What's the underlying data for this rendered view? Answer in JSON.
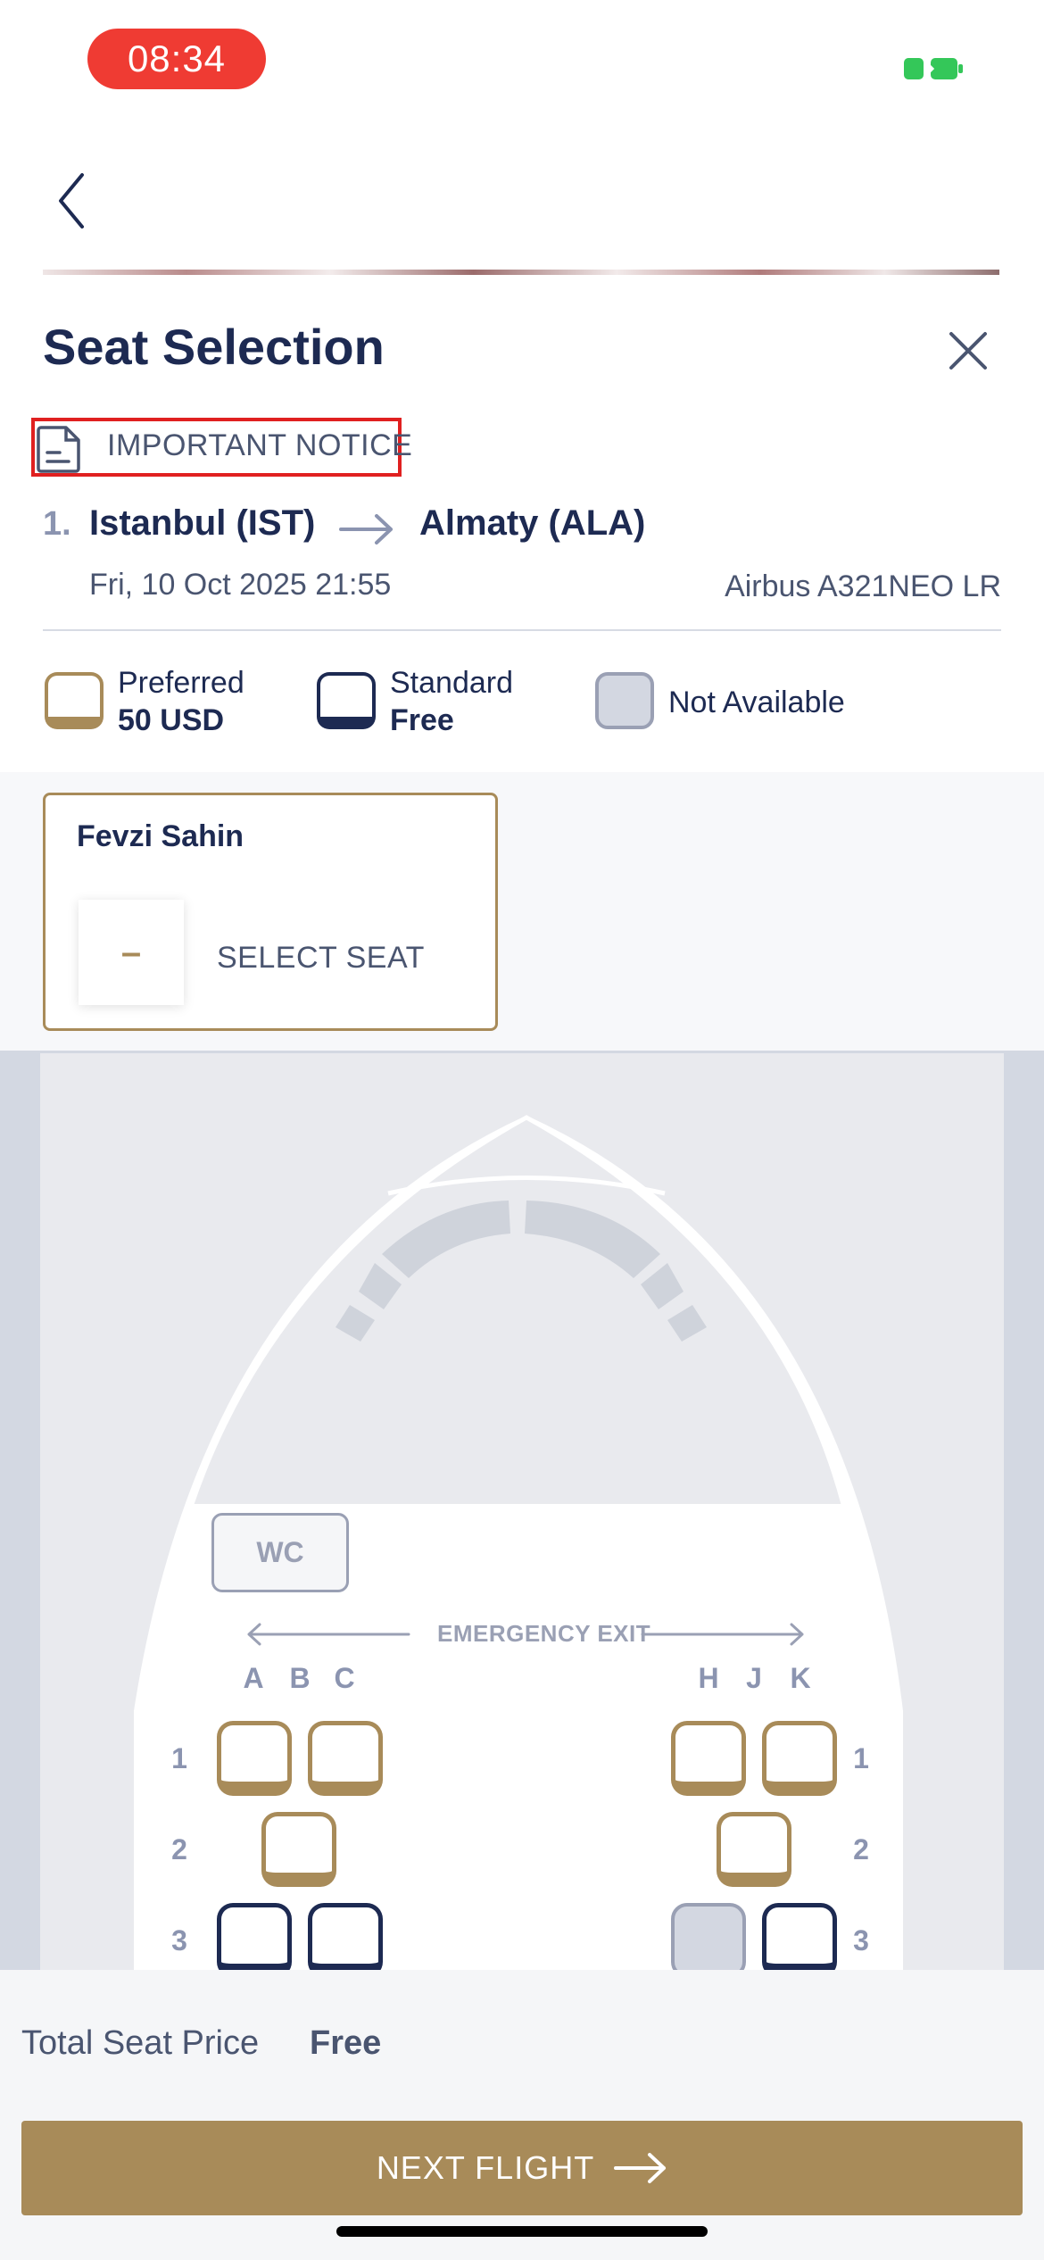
{
  "status_bar": {
    "time": "08:34"
  },
  "header": {
    "title": "Seat Selection",
    "notice": "IMPORTANT NOTICE"
  },
  "segment": {
    "number": "1.",
    "from": "Istanbul (IST)",
    "to": "Almaty (ALA)",
    "datetime": "Fri, 10 Oct 2025 21:55",
    "aircraft": "Airbus A321NEO LR"
  },
  "legend": {
    "preferred_label": "Preferred",
    "preferred_price": "50 USD",
    "standard_label": "Standard",
    "standard_price": "Free",
    "na_label": "Not Available"
  },
  "passenger": {
    "name": "Fevzi Sahin",
    "seat": "–",
    "action": "SELECT SEAT"
  },
  "seat_map": {
    "wc_label": "WC",
    "exit_label": "EMERGENCY EXIT",
    "left_columns": [
      "A",
      "B",
      "C"
    ],
    "right_columns": [
      "H",
      "J",
      "K"
    ],
    "rows": [
      {
        "label": "1",
        "seats": [
          {
            "col": "A",
            "status": "preferred"
          },
          {
            "col": "C",
            "status": "preferred"
          },
          {
            "col": "H",
            "status": "preferred"
          },
          {
            "col": "K",
            "status": "preferred"
          }
        ]
      },
      {
        "label": "2",
        "seats": [
          {
            "col": "B",
            "status": "preferred"
          },
          {
            "col": "J",
            "status": "preferred"
          }
        ]
      },
      {
        "label": "3",
        "seats": [
          {
            "col": "A",
            "status": "standard"
          },
          {
            "col": "C",
            "status": "standard"
          },
          {
            "col": "H",
            "status": "not-available"
          },
          {
            "col": "K",
            "status": "standard"
          }
        ]
      }
    ]
  },
  "footer": {
    "total_label": "Total Seat Price",
    "total_value": "Free",
    "next_label": "NEXT FLIGHT"
  },
  "colors": {
    "accent": "#a88b59",
    "navy": "#1d2a52",
    "unavailable": "#d3d7e1",
    "time_pill": "#ef3b33"
  }
}
